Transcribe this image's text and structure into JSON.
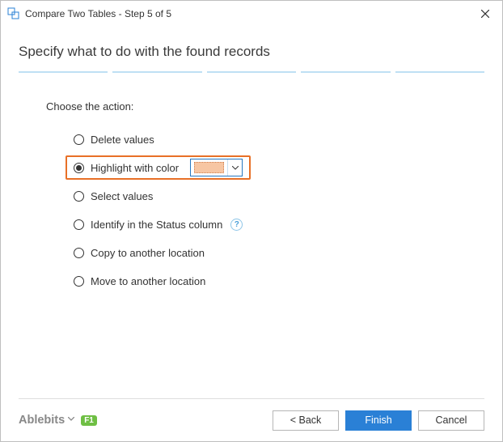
{
  "titlebar": {
    "title": "Compare Two Tables - Step 5 of 5"
  },
  "heading": "Specify what to do with the found records",
  "section_label": "Choose the action:",
  "options": {
    "delete": "Delete values",
    "highlight": "Highlight with color",
    "select": "Select values",
    "identify": "Identify in the Status column",
    "copy": "Copy to another location",
    "move": "Move to another location"
  },
  "selected_option": "highlight",
  "highlight_color": "#f7c6a3",
  "footer": {
    "brand": "Ablebits",
    "f1": "F1",
    "back": "< Back",
    "finish": "Finish",
    "cancel": "Cancel"
  }
}
